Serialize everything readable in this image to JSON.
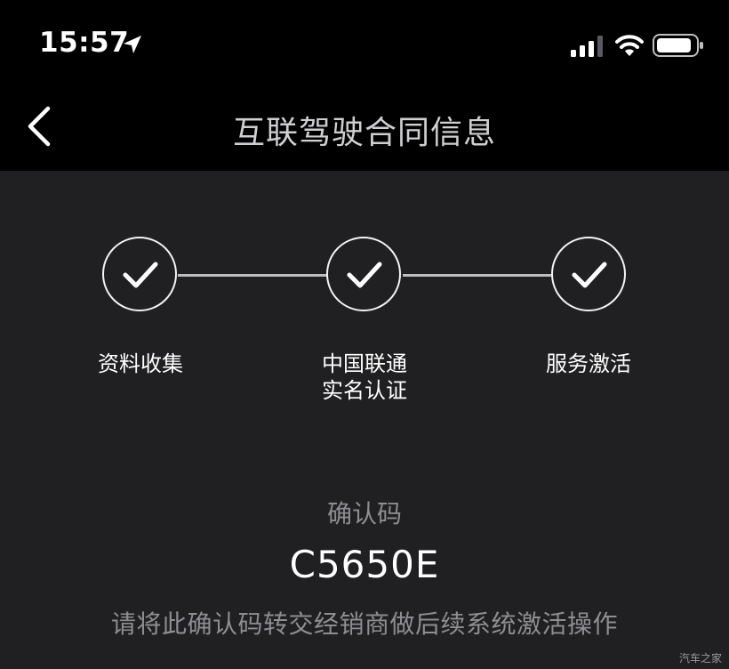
{
  "status_bar": {
    "time": "15:57",
    "icons": [
      "location-arrow-icon",
      "cellular-signal-icon",
      "wifi-icon",
      "battery-icon"
    ]
  },
  "nav": {
    "back_icon": "chevron-left-icon",
    "title": "互联驾驶合同信息"
  },
  "steps": [
    {
      "label": "资料收集",
      "status": "completed",
      "icon": "checkmark-icon"
    },
    {
      "label_line1": "中国联通",
      "label_line2": "实名认证",
      "status": "completed",
      "icon": "checkmark-icon"
    },
    {
      "label": "服务激活",
      "status": "completed",
      "icon": "checkmark-icon"
    }
  ],
  "confirmation": {
    "title": "确认码",
    "code": "C5650E",
    "hint": "请将此确认码转交经销商做后续系统激活操作"
  },
  "watermark": "汽车之家",
  "colors": {
    "header_bg": "#000000",
    "body_bg": "#202022",
    "muted_text": "#8e8e92"
  }
}
